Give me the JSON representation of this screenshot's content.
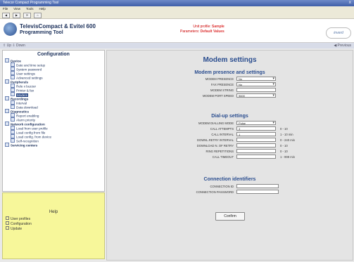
{
  "window": {
    "title": "Telecor Compact Programming Tool",
    "close": "X"
  },
  "menu": [
    "File",
    "View",
    "Tools",
    "Help"
  ],
  "toolbar": [
    "◀",
    "▶",
    "⟳",
    "⌂"
  ],
  "header": {
    "title": "TelevisCompact & Evitel 600",
    "subtitle": "Programming Tool",
    "info_label1": "Unit profile:",
    "info_value1": "Sample",
    "info_label2": "Parameters:",
    "info_value2": "Default Values",
    "brand": "inverd"
  },
  "nav": {
    "up": "⇧ Up",
    "down": "⇩ Down",
    "previous": "◀ Previous"
  },
  "sidebar": {
    "title": "Configuration",
    "items": [
      {
        "label": "Device",
        "level": 0
      },
      {
        "label": "Date and time setup",
        "level": 1
      },
      {
        "label": "System password",
        "level": 1
      },
      {
        "label": "User settings",
        "level": 1
      },
      {
        "label": "Advanced settings",
        "level": 1
      },
      {
        "label": "Peripherals",
        "level": 0
      },
      {
        "label": "Rele x buzzer",
        "level": 1
      },
      {
        "label": "Printer & fax",
        "level": 1
      },
      {
        "label": "Modem",
        "level": 1,
        "selected": true
      },
      {
        "label": "Recordings",
        "level": 0
      },
      {
        "label": "Interval",
        "level": 1
      },
      {
        "label": "Data download",
        "level": 1
      },
      {
        "label": "Diagnostics",
        "level": 0
      },
      {
        "label": "Report enabling",
        "level": 1
      },
      {
        "label": "Alarm priority",
        "level": 1
      },
      {
        "label": "Network configuration",
        "level": 0
      },
      {
        "label": "Load from user profile",
        "level": 1
      },
      {
        "label": "Load config from file",
        "level": 1
      },
      {
        "label": "Load config. from device",
        "level": 1
      },
      {
        "label": "Self-recognition",
        "level": 1
      },
      {
        "label": "Servicing centers",
        "level": 0
      }
    ]
  },
  "help": {
    "title": "Help",
    "items": [
      "User profiles",
      "Configuration",
      "Update"
    ]
  },
  "main": {
    "title": "Modem settings",
    "section1": {
      "title": "Modem presence and settings",
      "rows": [
        {
          "label": "MODEM PRESENCE",
          "value": "No",
          "type": "select"
        },
        {
          "label": "FAX PRESENCE",
          "value": "No",
          "type": "select"
        },
        {
          "label": "MODEM STRING",
          "value": "",
          "type": "text"
        },
        {
          "label": "MODEM PORT SPEED",
          "value": "9600",
          "type": "select"
        }
      ]
    },
    "section2": {
      "title": "Dial-up settings",
      "rows": [
        {
          "label": "MODEM DIALLING MODE",
          "value": "Pulse",
          "type": "select",
          "range": ""
        },
        {
          "label": "CALL ATTEMPTS",
          "value": "3",
          "type": "text",
          "range": "0 - 10"
        },
        {
          "label": "CALL INTERVAL",
          "value": "1",
          "type": "text",
          "range": "1 - 10 min"
        },
        {
          "label": "DOWNL.RETRY INTERVAL",
          "value": "",
          "type": "text",
          "range": "0 - 240 min"
        },
        {
          "label": "DOWNLOAD N. OF RETRY",
          "value": "",
          "type": "text",
          "range": "0 - 10"
        },
        {
          "label": "RING REPETITIONS",
          "value": "",
          "type": "text",
          "range": "0 - 10"
        },
        {
          "label": "CALL TIMEOUT",
          "value": "",
          "type": "text",
          "range": "1 - 999 min"
        }
      ]
    },
    "section3": {
      "title": "Connection identifiers",
      "rows": [
        {
          "label": "CONNECTION ID",
          "value": ""
        },
        {
          "label": "CONNECTION PASSWORD",
          "value": ""
        }
      ]
    },
    "confirm": "Confirm"
  }
}
